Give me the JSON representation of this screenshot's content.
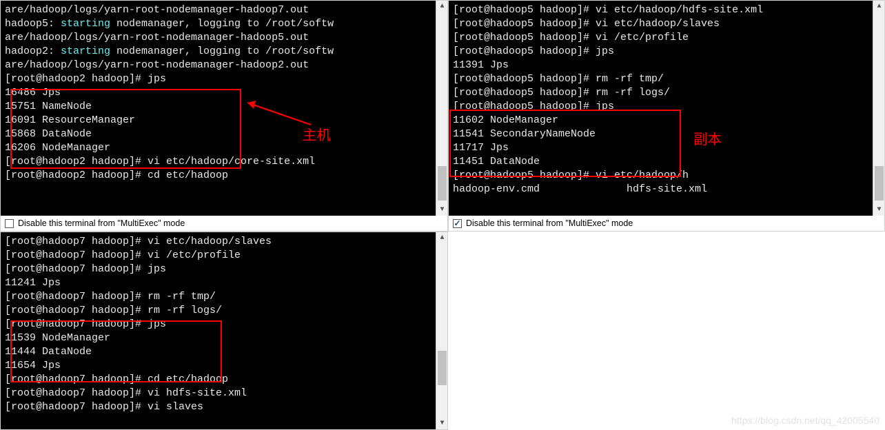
{
  "footer": {
    "multiexec_label": "Disable this terminal from \"MultiExec\" mode"
  },
  "annotations": {
    "left_label": "主机",
    "right_label": "副本"
  },
  "watermark": "https://blog.csdn.net/qq_42005540",
  "pane1": {
    "lines": [
      {
        "segs": [
          {
            "t": "are/hadoop/logs/yarn-root-nodemanager-hadoop7.out"
          }
        ]
      },
      {
        "segs": [
          {
            "t": "hadoop5: "
          },
          {
            "t": "starting",
            "c": "cyan"
          },
          {
            "t": " nodemanager, logging to /root/softw"
          }
        ]
      },
      {
        "segs": [
          {
            "t": "are/hadoop/logs/yarn-root-nodemanager-hadoop5.out"
          }
        ]
      },
      {
        "segs": [
          {
            "t": "hadoop2: "
          },
          {
            "t": "starting",
            "c": "cyan"
          },
          {
            "t": " nodemanager, logging to /root/softw"
          }
        ]
      },
      {
        "segs": [
          {
            "t": "are/hadoop/logs/yarn-root-nodemanager-hadoop2.out"
          }
        ]
      },
      {
        "segs": [
          {
            "t": "[root@hadoop2 hadoop]# jps"
          }
        ]
      },
      {
        "segs": [
          {
            "t": "16486 Jps"
          }
        ]
      },
      {
        "segs": [
          {
            "t": "15751 NameNode"
          }
        ]
      },
      {
        "segs": [
          {
            "t": "16091 ResourceManager"
          }
        ]
      },
      {
        "segs": [
          {
            "t": "15868 DataNode"
          }
        ]
      },
      {
        "segs": [
          {
            "t": "16206 NodeManager"
          }
        ]
      },
      {
        "segs": [
          {
            "t": "[root@hadoop2 hadoop]# vi etc/hadoop/core-site.xml"
          }
        ]
      },
      {
        "segs": [
          {
            "t": "[root@hadoop2 hadoop]# cd etc/hadoop"
          }
        ]
      }
    ]
  },
  "pane2": {
    "lines": [
      {
        "segs": [
          {
            "t": "[root@hadoop5 hadoop]# vi etc/hadoop/hdfs-site.xml"
          }
        ]
      },
      {
        "segs": [
          {
            "t": "[root@hadoop5 hadoop]# vi etc/hadoop/slaves"
          }
        ]
      },
      {
        "segs": [
          {
            "t": "[root@hadoop5 hadoop]# vi /etc/profile"
          }
        ]
      },
      {
        "segs": [
          {
            "t": "[root@hadoop5 hadoop]# jps"
          }
        ]
      },
      {
        "segs": [
          {
            "t": "11391 Jps"
          }
        ]
      },
      {
        "segs": [
          {
            "t": "[root@hadoop5 hadoop]# rm -rf tmp/"
          }
        ]
      },
      {
        "segs": [
          {
            "t": "[root@hadoop5 hadoop]# rm -rf logs/"
          }
        ]
      },
      {
        "segs": [
          {
            "t": "[root@hadoop5 hadoop]# jps"
          }
        ]
      },
      {
        "segs": [
          {
            "t": "11602 NodeManager"
          }
        ]
      },
      {
        "segs": [
          {
            "t": "11541 SecondaryNameNode"
          }
        ]
      },
      {
        "segs": [
          {
            "t": "11717 Jps"
          }
        ]
      },
      {
        "segs": [
          {
            "t": "11451 DataNode"
          }
        ]
      },
      {
        "segs": [
          {
            "t": "[root@hadoop5 hadoop]# vi etc/hadoop/h"
          }
        ]
      },
      {
        "segs": [
          {
            "t": "hadoop-env.cmd              hdfs-site.xml"
          }
        ]
      }
    ]
  },
  "pane3": {
    "lines": [
      {
        "segs": [
          {
            "t": "[root@hadoop7 hadoop]# vi etc/hadoop/slaves"
          }
        ]
      },
      {
        "segs": [
          {
            "t": "[root@hadoop7 hadoop]# vi /etc/profile"
          }
        ]
      },
      {
        "segs": [
          {
            "t": "[root@hadoop7 hadoop]# jps"
          }
        ]
      },
      {
        "segs": [
          {
            "t": "11241 Jps"
          }
        ]
      },
      {
        "segs": [
          {
            "t": "[root@hadoop7 hadoop]# rm -rf tmp/"
          }
        ]
      },
      {
        "segs": [
          {
            "t": "[root@hadoop7 hadoop]# rm -rf logs/"
          }
        ]
      },
      {
        "segs": [
          {
            "t": "[root@hadoop7 hadoop]# jps"
          }
        ]
      },
      {
        "segs": [
          {
            "t": "11539 NodeManager"
          }
        ]
      },
      {
        "segs": [
          {
            "t": "11444 DataNode"
          }
        ]
      },
      {
        "segs": [
          {
            "t": "11654 Jps"
          }
        ]
      },
      {
        "segs": [
          {
            "t": "[root@hadoop7 hadoop]# cd etc/hadoop"
          }
        ]
      },
      {
        "segs": [
          {
            "t": "[root@hadoop7 hadoop]# vi hdfs-site.xml"
          }
        ]
      },
      {
        "segs": [
          {
            "t": "[root@hadoop7 hadoop]# vi slaves"
          }
        ]
      }
    ]
  }
}
